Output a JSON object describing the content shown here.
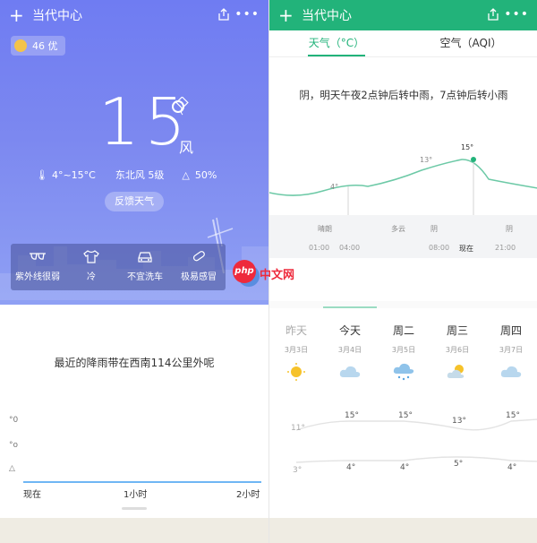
{
  "left": {
    "header": {
      "title": "当代中心",
      "plus": "+",
      "more": "•••"
    },
    "aqi_chip": {
      "value": "46 优"
    },
    "temp_now": "15",
    "wind_word": "风",
    "meta": {
      "range": "4°~15°C",
      "wind": "东北风 5级",
      "humidity": "50%"
    },
    "feedback_label": "反馈天气",
    "life_items": [
      {
        "label": "紫外线很弱",
        "icon": "sunglasses-icon"
      },
      {
        "label": "冷",
        "icon": "shirt-icon"
      },
      {
        "label": "不宜洗车",
        "icon": "car-icon"
      },
      {
        "label": "极易感冒",
        "icon": "pill-icon"
      }
    ],
    "rain_text": "最近的降雨带在西南114公里外呢",
    "x_labels": [
      "现在",
      "1小时",
      "2小时"
    ]
  },
  "right": {
    "header": {
      "title": "当代中心",
      "plus": "+",
      "more": "•••"
    },
    "tabs": [
      "天气（°C）",
      "空气（AQI）"
    ],
    "forecast_text": "阴，明天午夜2点钟后转中雨，7点钟后转小雨",
    "curve_labels": [
      "4°",
      "13°",
      "15°"
    ],
    "hourly_conditions": [
      "晴朗",
      "多云",
      "阴",
      "阴"
    ],
    "hourly_times": [
      "01:00",
      "04:00",
      "08:00",
      "现在",
      "21:00"
    ],
    "days": [
      {
        "name": "昨天",
        "date": "3月3日",
        "icon": "sun-icon",
        "hi": "11°",
        "lo": "3°"
      },
      {
        "name": "今天",
        "date": "3月4日",
        "icon": "cloud-icon",
        "hi": "15°",
        "lo": "4°"
      },
      {
        "name": "周二",
        "date": "3月5日",
        "icon": "rain-cloud-icon",
        "hi": "15°",
        "lo": "4°"
      },
      {
        "name": "周三",
        "date": "3月6日",
        "icon": "partly-cloudy-icon",
        "hi": "13°",
        "lo": "5°"
      },
      {
        "name": "周四",
        "date": "3月7日",
        "icon": "cloud-icon",
        "hi": "15°",
        "lo": "4°"
      }
    ]
  },
  "watermark": {
    "logo": "php",
    "text": "中文网"
  },
  "colors": {
    "primary_green": "#22b37a",
    "hero_blue": "#7482f1",
    "rain_axis": "#6fb6f4"
  }
}
